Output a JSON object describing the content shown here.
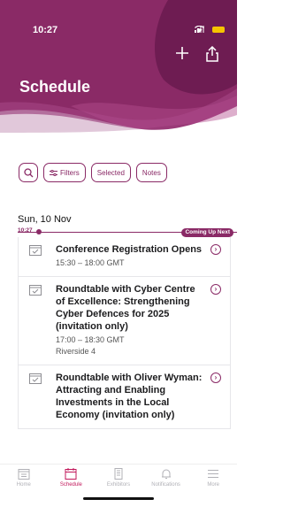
{
  "status_bar": {
    "time": "10:27"
  },
  "header": {
    "title": "Schedule",
    "add_icon": "plus-icon",
    "share_icon": "share-icon",
    "colors": {
      "primary": "#8a2a66",
      "dark": "#6e1c52",
      "light": "#b44d8e"
    }
  },
  "filters": {
    "search_icon": "search-icon",
    "filters_label": "Filters",
    "selected_label": "Selected",
    "notes_label": "Notes"
  },
  "timeline": {
    "day": "Sun, 10 Nov",
    "now_time": "10:27",
    "coming_badge": "Coming Up Next"
  },
  "events": [
    {
      "title": "Conference Registration Opens",
      "time": "15:30 – 18:00 GMT",
      "location": ""
    },
    {
      "title": "Roundtable with Cyber Centre of Excellence: Strengthening Cyber Defences for 2025 (invitation only)",
      "time": "17:00 – 18:30 GMT",
      "location": "Riverside 4"
    },
    {
      "title": "Roundtable with Oliver Wyman: Attracting and Enabling Investments in the Local Economy  (invitation only)",
      "time": "",
      "location": ""
    }
  ],
  "tabs": [
    {
      "label": "Home",
      "icon": "home-icon"
    },
    {
      "label": "Schedule",
      "icon": "calendar-icon",
      "active": true
    },
    {
      "label": "Exhibitors",
      "icon": "exhibitors-icon"
    },
    {
      "label": "Notifications",
      "icon": "bell-icon"
    },
    {
      "label": "More",
      "icon": "menu-icon"
    }
  ]
}
